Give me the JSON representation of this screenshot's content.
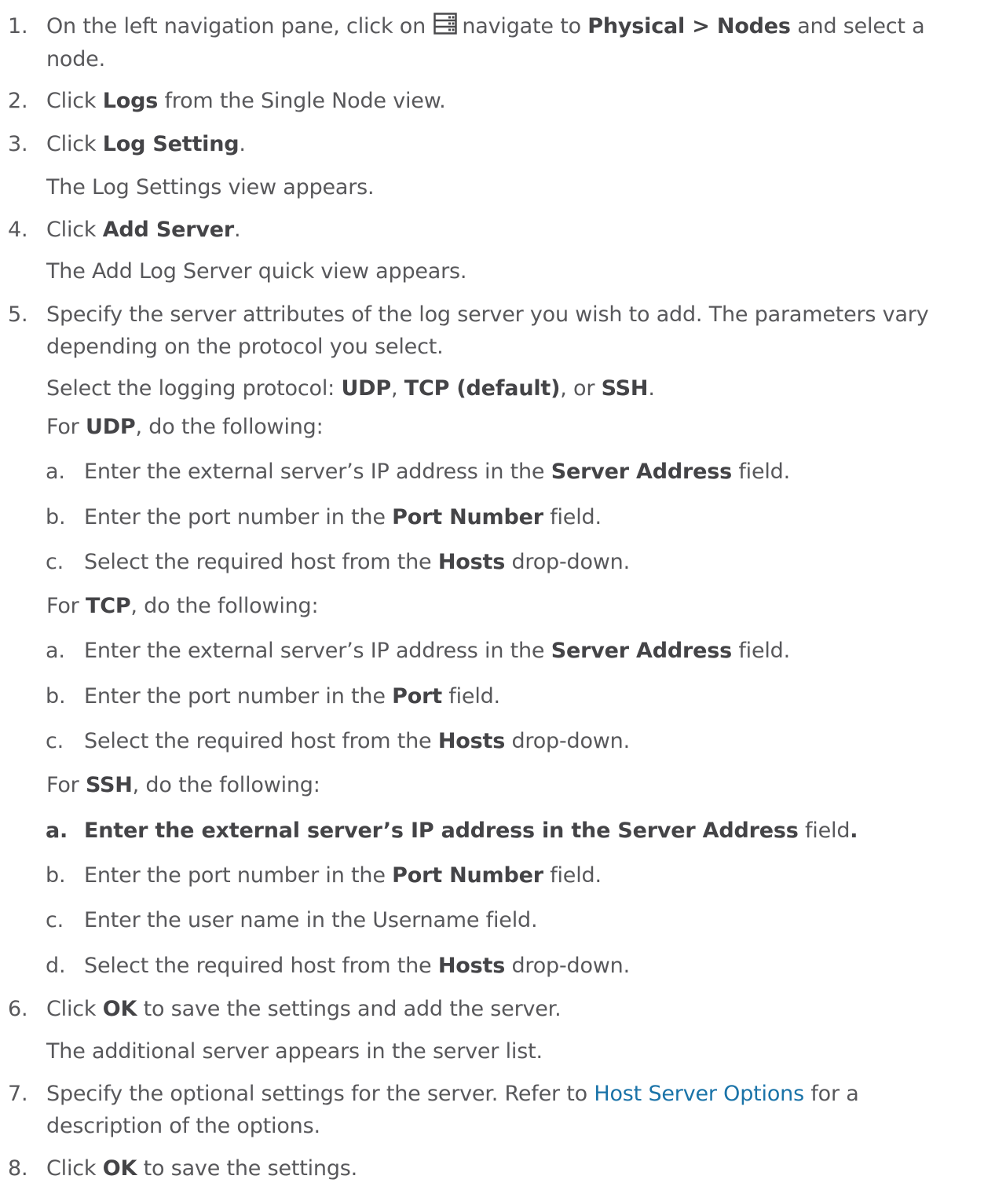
{
  "steps": [
    {
      "num": "1.",
      "pre": "On the left navigation pane, click on",
      "mid": "navigate to",
      "bold": "Physical > Nodes",
      "post": "and select a",
      "line2": "node.",
      "icon": "nodes-list-icon"
    },
    {
      "num": "2.",
      "pre": "Click",
      "bold": "Logs",
      "post": "from the Single Node view."
    },
    {
      "num": "3.",
      "pre": "Click",
      "bold": "Log Setting",
      "post": ".",
      "para": "The Log Settings view appears."
    },
    {
      "num": "4.",
      "pre": "Click",
      "bold": "Add Server",
      "post": ".",
      "para": "The Add Log Server quick view appears."
    },
    {
      "num": "5.",
      "line1": "Specify the server attributes of the log server you wish to add. The parameters vary",
      "line2": "depending on the protocol you select.",
      "protocol_pre": "Select the logging protocol:",
      "p1": "UDP",
      "sep1": ",",
      "p2": "TCP (default)",
      "sep2": ", or",
      "p3": "SSH",
      "end": "."
    },
    {
      "num": "6.",
      "pre": "Click",
      "bold": "OK",
      "post": "to save the settings and add the server.",
      "para": "The additional server appears in the server list."
    },
    {
      "num": "7.",
      "pre": "Specify the optional settings for the server. Refer to",
      "link": "Host Server Options",
      "post": "for a",
      "line2": "description of the options."
    },
    {
      "num": "8.",
      "pre": "Click",
      "bold": "OK",
      "post": "to save the settings."
    }
  ],
  "udp": {
    "head_pre": "For",
    "head_bold": "UDP",
    "head_post": ", do the following:",
    "items": [
      {
        "letter": "a.",
        "pre": "Enter the external server’s IP address in the",
        "bold": "Server Address",
        "post": "field."
      },
      {
        "letter": "b.",
        "pre": "Enter the port number in the",
        "bold": "Port Number",
        "post": "field."
      },
      {
        "letter": "c.",
        "pre": "Select the required host from the",
        "bold": "Hosts",
        "post": "drop-down."
      }
    ]
  },
  "tcp": {
    "head_pre": "For",
    "head_bold": "TCP",
    "head_post": ", do the following:",
    "items": [
      {
        "letter": "a.",
        "pre": "Enter the external server’s IP address in the",
        "bold": "Server Address",
        "post": "field."
      },
      {
        "letter": "b.",
        "pre": "Enter the port number in the",
        "bold": "Port",
        "post": "field."
      },
      {
        "letter": "c.",
        "pre": "Select the required host from the",
        "bold": "Hosts",
        "post": "drop-down."
      }
    ]
  },
  "ssh": {
    "head_pre": "For",
    "head_bold": "SSH",
    "head_post": ", do the following:",
    "items": [
      {
        "letter": "a.",
        "bold": "Enter the external server’s IP address in the Server Address",
        "post": "field",
        "end": "."
      },
      {
        "letter": "b.",
        "pre": "Enter the port number in the",
        "bold": "Port Number",
        "post": "field."
      },
      {
        "letter": "c.",
        "pre": "Enter the user name in the Username field."
      },
      {
        "letter": "d.",
        "pre": "Select the required host from the",
        "bold": "Hosts",
        "post": "drop-down."
      }
    ]
  }
}
